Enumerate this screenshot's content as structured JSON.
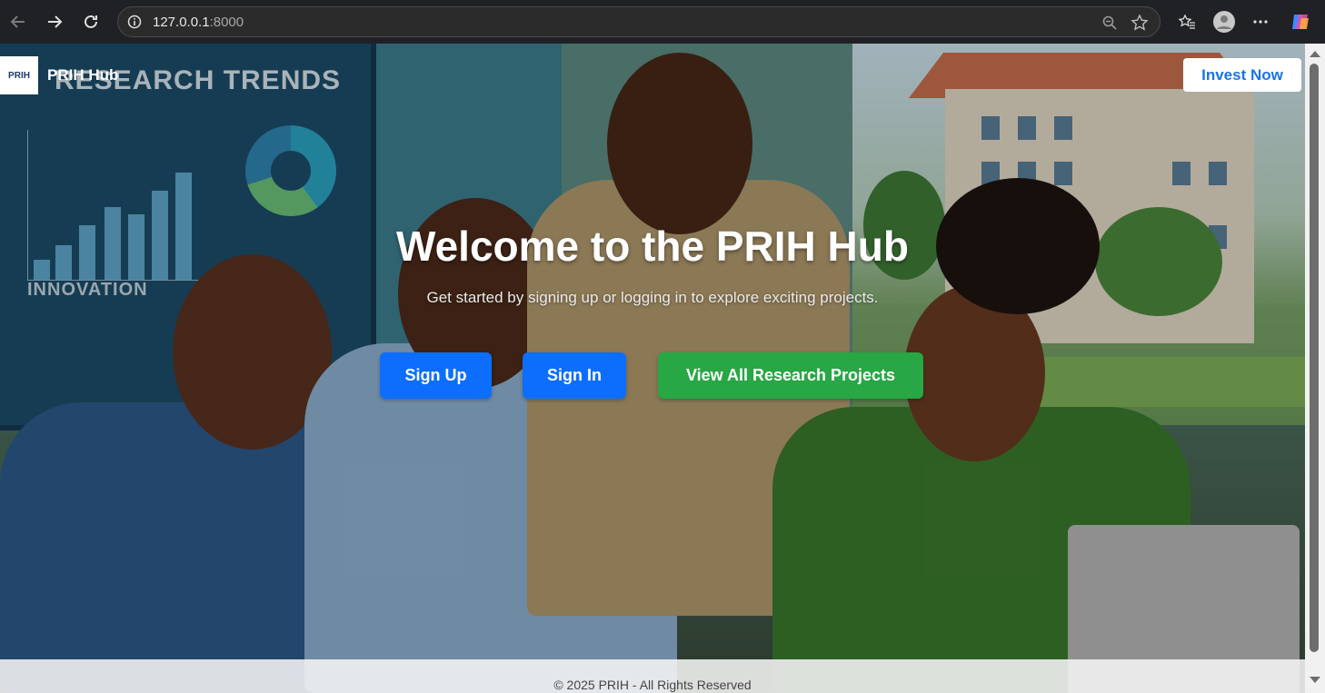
{
  "browser": {
    "url_host": "127.0.0.1",
    "url_port": ":8000"
  },
  "navbar": {
    "logo_text": "PRIH",
    "brand": "PRIH Hub",
    "invest_label": "Invest Now"
  },
  "hero": {
    "title": "Welcome to the PRIH Hub",
    "subtitle": "Get started by signing up or logging in to explore exciting projects.",
    "signup_label": "Sign Up",
    "signin_label": "Sign In",
    "projects_label": "View All Research Projects",
    "board_heading": "RESEARCH TRENDS",
    "board_subheading": "INNOVATION"
  },
  "footer": {
    "text": "© 2025 PRIH - All Rights Reserved"
  },
  "colors": {
    "primary": "#0d6efd",
    "success": "#28a745",
    "link": "#1a73e8"
  }
}
